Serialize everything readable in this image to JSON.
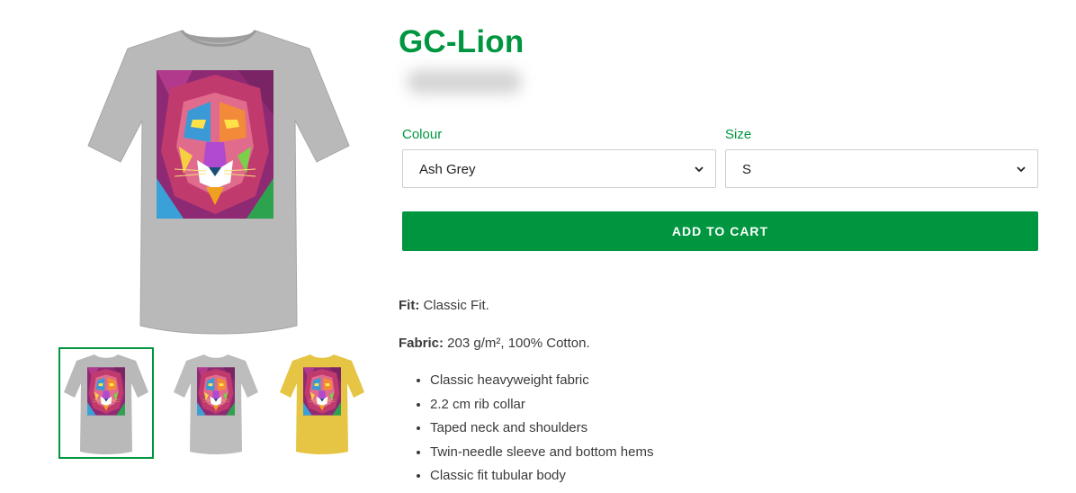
{
  "product": {
    "title": "GC-Lion",
    "image_alt": "Lion pop-art print t-shirt"
  },
  "gallery": {
    "thumbnails": [
      {
        "shirt_color": "#b9b9b9",
        "selected": true
      },
      {
        "shirt_color": "#bdbdbd",
        "selected": false
      },
      {
        "shirt_color": "#e6c545",
        "selected": false
      }
    ]
  },
  "options": {
    "colour": {
      "label": "Colour",
      "value": "Ash Grey"
    },
    "size": {
      "label": "Size",
      "value": "S"
    }
  },
  "cart": {
    "button_label": "ADD TO CART"
  },
  "specs": {
    "fit_label": "Fit:",
    "fit_value": " Classic Fit.",
    "fabric_label": "Fabric:",
    "fabric_value": " 203 g/m², 100% Cotton."
  },
  "features": [
    "Classic heavyweight fabric",
    "2.2 cm rib collar",
    "Taped neck and shoulders",
    "Twin-needle sleeve and bottom hems",
    "Classic fit tubular body"
  ],
  "colors": {
    "accent": "#009640",
    "text": "#3a3a3a",
    "border": "#cfcfcf"
  }
}
